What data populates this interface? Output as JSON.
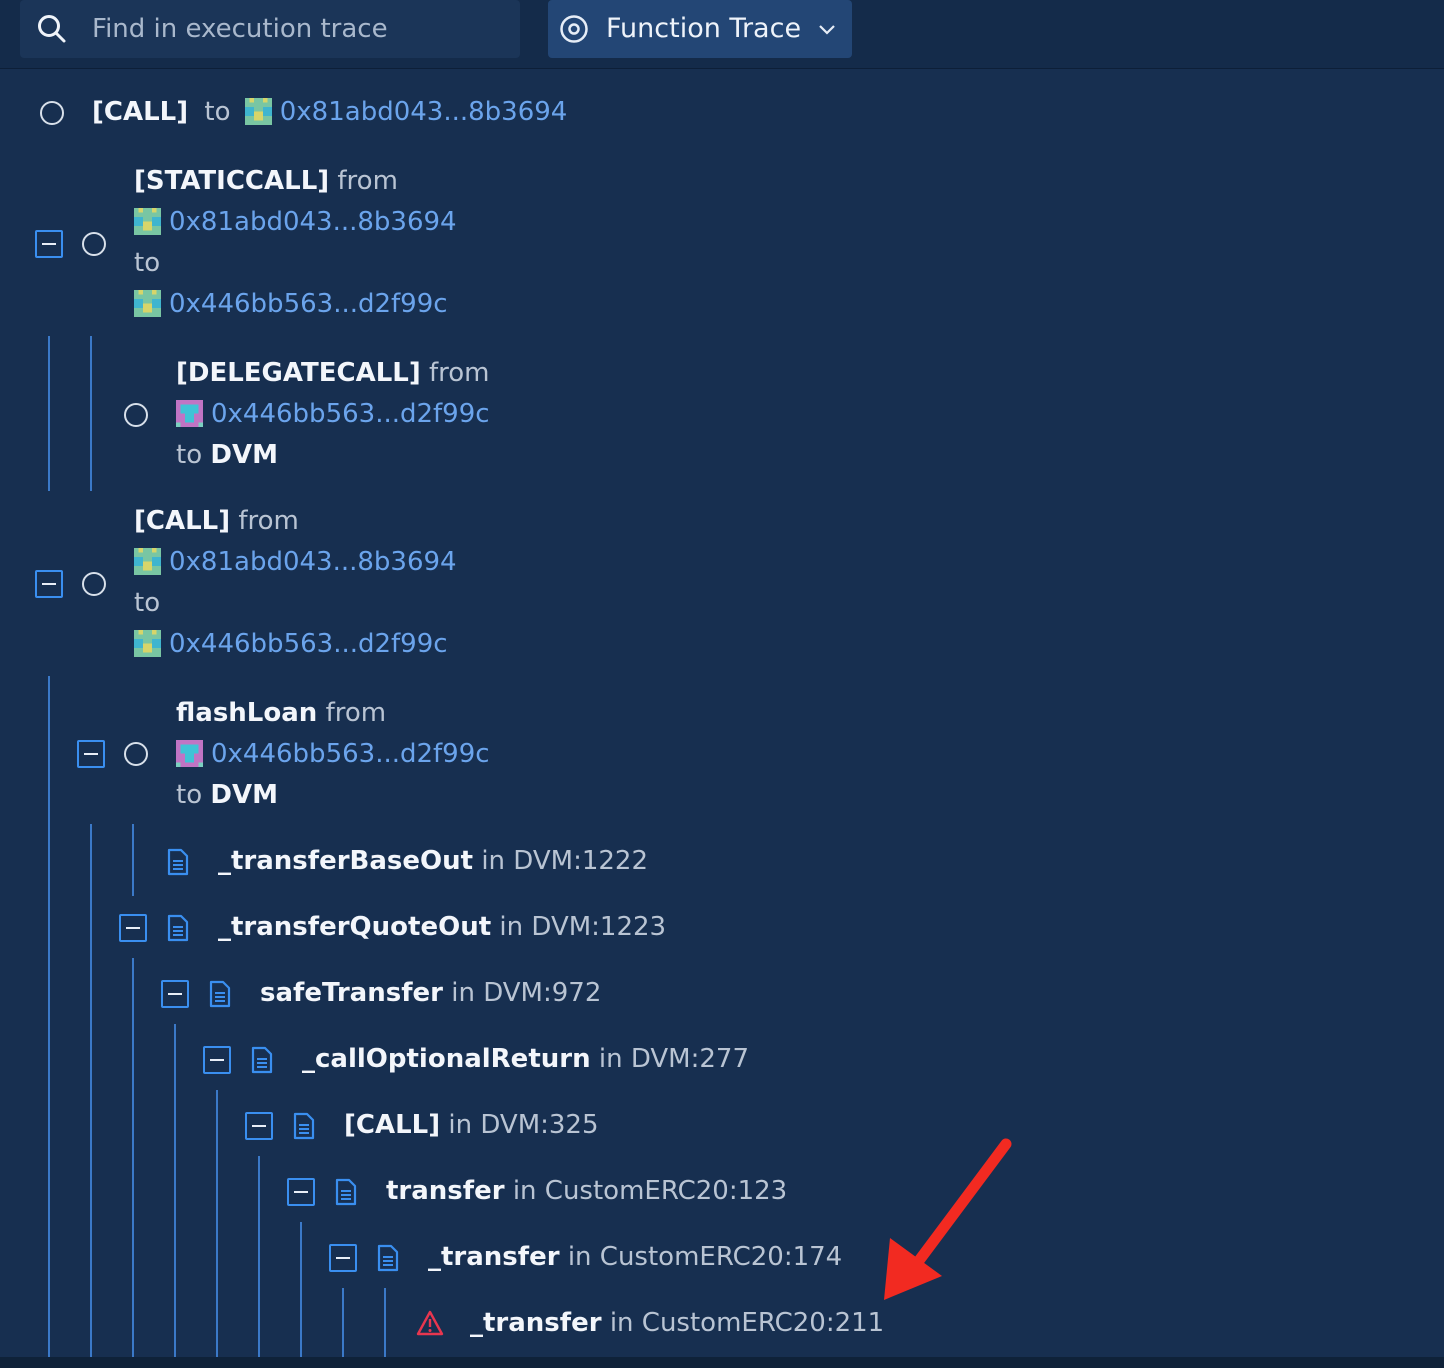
{
  "toolbar": {
    "search_placeholder": "Find in execution trace",
    "mode_label": "Function Trace"
  },
  "colors": {
    "background": "#172f50",
    "accent": "#3a8ff0",
    "address": "#6ba4ec",
    "error": "#e8364f",
    "annotation_arrow": "#f22a21"
  },
  "trace": [
    {
      "kind": "CALL",
      "call": "[CALL]",
      "to_word": "to",
      "to": "0x81abd043...8b3694"
    },
    {
      "kind": "STATICCALL",
      "call": "[STATICCALL]",
      "from_word": "from",
      "from": "0x81abd043...8b3694",
      "to_word": "to",
      "to": "0x446bb563...d2f99c"
    },
    {
      "kind": "DELEGATECALL",
      "call": "[DELEGATECALL]",
      "from_word": "from",
      "from": "0x446bb563...d2f99c",
      "to_word": "to",
      "to": "DVM"
    },
    {
      "kind": "CALL",
      "call": "[CALL]",
      "from_word": "from",
      "from": "0x81abd043...8b3694",
      "to_word": "to",
      "to": "0x446bb563...d2f99c"
    },
    {
      "kind": "function",
      "name": "flashLoan",
      "from_word": "from",
      "from": "0x446bb563...d2f99c",
      "to_word": "to",
      "to": "DVM"
    },
    {
      "kind": "function",
      "name": "_transferBaseOut",
      "in_word": "in",
      "location": "DVM:1222"
    },
    {
      "kind": "function",
      "name": "_transferQuoteOut",
      "in_word": "in",
      "location": "DVM:1223"
    },
    {
      "kind": "function",
      "name": "safeTransfer",
      "in_word": "in",
      "location": "DVM:972"
    },
    {
      "kind": "function",
      "name": "_callOptionalReturn",
      "in_word": "in",
      "location": "DVM:277"
    },
    {
      "kind": "function",
      "name": "[CALL]",
      "in_word": "in",
      "location": "DVM:325"
    },
    {
      "kind": "function",
      "name": "transfer",
      "in_word": "in",
      "location": "CustomERC20:123"
    },
    {
      "kind": "function",
      "name": "_transfer",
      "in_word": "in",
      "location": "CustomERC20:174"
    },
    {
      "kind": "error",
      "name": "_transfer",
      "in_word": "in",
      "location": "CustomERC20:211"
    }
  ]
}
